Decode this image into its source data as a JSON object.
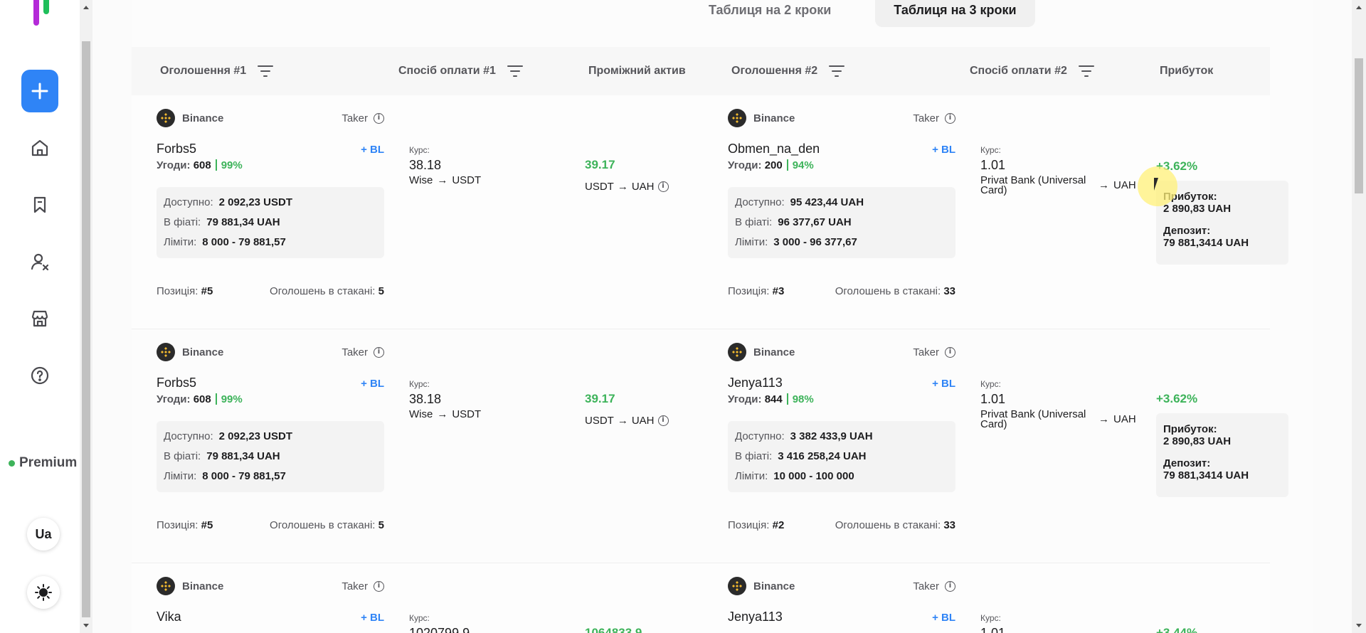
{
  "tabs": [
    {
      "label": "Таблиця на 2 кроки",
      "active": false
    },
    {
      "label": "Таблиця на 3 кроки",
      "active": true
    }
  ],
  "columns": {
    "ad1": "Оголошення #1",
    "pay1": "Спосіб оплати #1",
    "asset": "Проміжний актив",
    "ad2": "Оголошення #2",
    "pay2": "Спосіб оплати #2",
    "profit": "Прибуток"
  },
  "sidebar": {
    "premium": "Premium",
    "lang": "Ua",
    "icons": [
      "plus-icon",
      "home-icon",
      "bookmark-icon",
      "user-x-icon",
      "store-icon",
      "help-icon",
      "sun-icon"
    ]
  },
  "labels": {
    "taker": "Taker",
    "bl": "+ BL",
    "deals": "Угоди:",
    "available": "Доступно:",
    "fiat": "В фіаті:",
    "limits": "Ліміти:",
    "position": "Позиція:",
    "in_book": "Оголошень в стакані:",
    "rate": "Курс:",
    "profit": "Прибуток:",
    "deposit": "Депозит:"
  },
  "rows": [
    {
      "ad1": {
        "exchange": "Binance",
        "name": "Forbs5",
        "deals": "608",
        "pct": "99%",
        "available": "2 092,23 USDT",
        "fiat": "79 881,34 UAH",
        "limits": "8 000 - 79 881,57",
        "position": "#5",
        "in_book": "5"
      },
      "pay1": {
        "rate": "38.18",
        "from": "Wise",
        "to": "USDT"
      },
      "asset": {
        "value": "39.17",
        "from": "USDT",
        "to": "UAH"
      },
      "ad2": {
        "exchange": "Binance",
        "name": "Obmen_na_den",
        "deals": "200",
        "pct": "94%",
        "available": "95 423,44 UAH",
        "fiat": "96 377,67 UAH",
        "limits": "3 000 - 96 377,67",
        "position": "#3",
        "in_book": "33"
      },
      "pay2": {
        "rate": "1.01",
        "from": "Privat Bank (Universal Card)",
        "to": "UAH"
      },
      "profit": {
        "pct": "+3.62%",
        "profit": "2 890,83 UAH",
        "deposit": "79 881,3414 UAH"
      }
    },
    {
      "ad1": {
        "exchange": "Binance",
        "name": "Forbs5",
        "deals": "608",
        "pct": "99%",
        "available": "2 092,23 USDT",
        "fiat": "79 881,34 UAH",
        "limits": "8 000 - 79 881,57",
        "position": "#5",
        "in_book": "5"
      },
      "pay1": {
        "rate": "38.18",
        "from": "Wise",
        "to": "USDT"
      },
      "asset": {
        "value": "39.17",
        "from": "USDT",
        "to": "UAH"
      },
      "ad2": {
        "exchange": "Binance",
        "name": "Jenya113",
        "deals": "844",
        "pct": "98%",
        "available": "3 382 433,9 UAH",
        "fiat": "3 416 258,24 UAH",
        "limits": "10 000 - 100 000",
        "position": "#2",
        "in_book": "33"
      },
      "pay2": {
        "rate": "1.01",
        "from": "Privat Bank (Universal Card)",
        "to": "UAH"
      },
      "profit": {
        "pct": "+3.62%",
        "profit": "2 890,83 UAH",
        "deposit": "79 881,3414 UAH"
      }
    },
    {
      "ad1": {
        "exchange": "Binance",
        "name": "Vika"
      },
      "pay1": {
        "rate": "1020799,9"
      },
      "asset": {
        "value": "1064833,9"
      },
      "ad2": {
        "exchange": "Binance",
        "name": "Jenya113"
      },
      "pay2": {
        "rate": "1.01"
      },
      "profit": {
        "pct": "+3.44%"
      }
    }
  ]
}
